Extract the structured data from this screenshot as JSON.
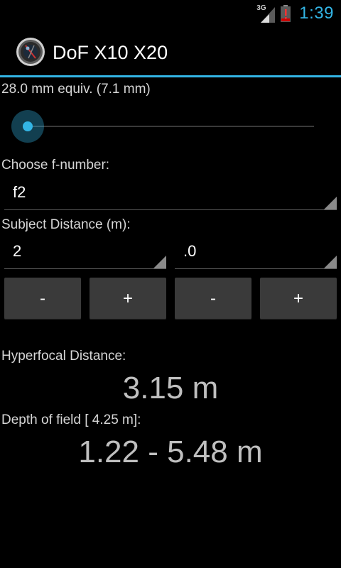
{
  "status_bar": {
    "network": "3G",
    "time": "1:39"
  },
  "app": {
    "title": "DoF X10 X20",
    "icon": "camera-lens-icon"
  },
  "focal": {
    "label": "28.0 mm equiv. (7.1 mm)",
    "slider_value": 0
  },
  "fnumber": {
    "label": "Choose f-number:",
    "selected": "f2"
  },
  "distance": {
    "label": "Subject Distance (m):",
    "whole": "2",
    "fraction": ".0",
    "buttons": {
      "whole_minus": "-",
      "whole_plus": "+",
      "fraction_minus": "-",
      "fraction_plus": "+"
    }
  },
  "hyperfocal": {
    "label": "Hyperfocal Distance:",
    "value": "3.15 m"
  },
  "dof": {
    "label": "Depth of field [ 4.25 m]:",
    "value": "1.22 - 5.48 m"
  },
  "colors": {
    "accent": "#33b5e5",
    "background": "#000000",
    "button": "#3a3a3a"
  }
}
